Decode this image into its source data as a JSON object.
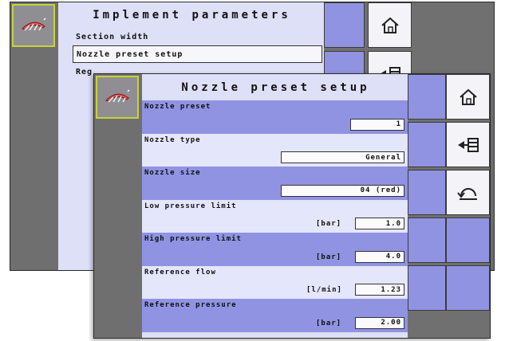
{
  "back_screen": {
    "title": "Implement parameters",
    "items": [
      {
        "label": "Section width"
      },
      {
        "label": "Nozzle preset setup"
      },
      {
        "label": "Reg"
      }
    ]
  },
  "front_screen": {
    "title": "Nozzle preset setup",
    "params": [
      {
        "label": "Nozzle preset",
        "unit": "",
        "value": "1"
      },
      {
        "label": "Nozzle type",
        "unit": "",
        "value": "General"
      },
      {
        "label": "Nozzle size",
        "unit": "",
        "value": "04 (red)"
      },
      {
        "label": "Low pressure limit",
        "unit": "[bar]",
        "value": "1.0"
      },
      {
        "label": "High pressure limit",
        "unit": "[bar]",
        "value": "4.0"
      },
      {
        "label": "Reference flow",
        "unit": "[l/min]",
        "value": "1.23"
      },
      {
        "label": "Reference pressure",
        "unit": "[bar]",
        "value": "2.00"
      }
    ]
  },
  "icons": {
    "home": "home-icon",
    "menu_back": "menu-back-icon",
    "undo": "undo-icon",
    "sprayer": "sprayer-icon"
  },
  "colors": {
    "selection_border": "#c9d23a",
    "row_dark": "#8f93e2",
    "row_light": "#e4e6fb",
    "panel": "#dde0f6",
    "frame": "#707070"
  }
}
